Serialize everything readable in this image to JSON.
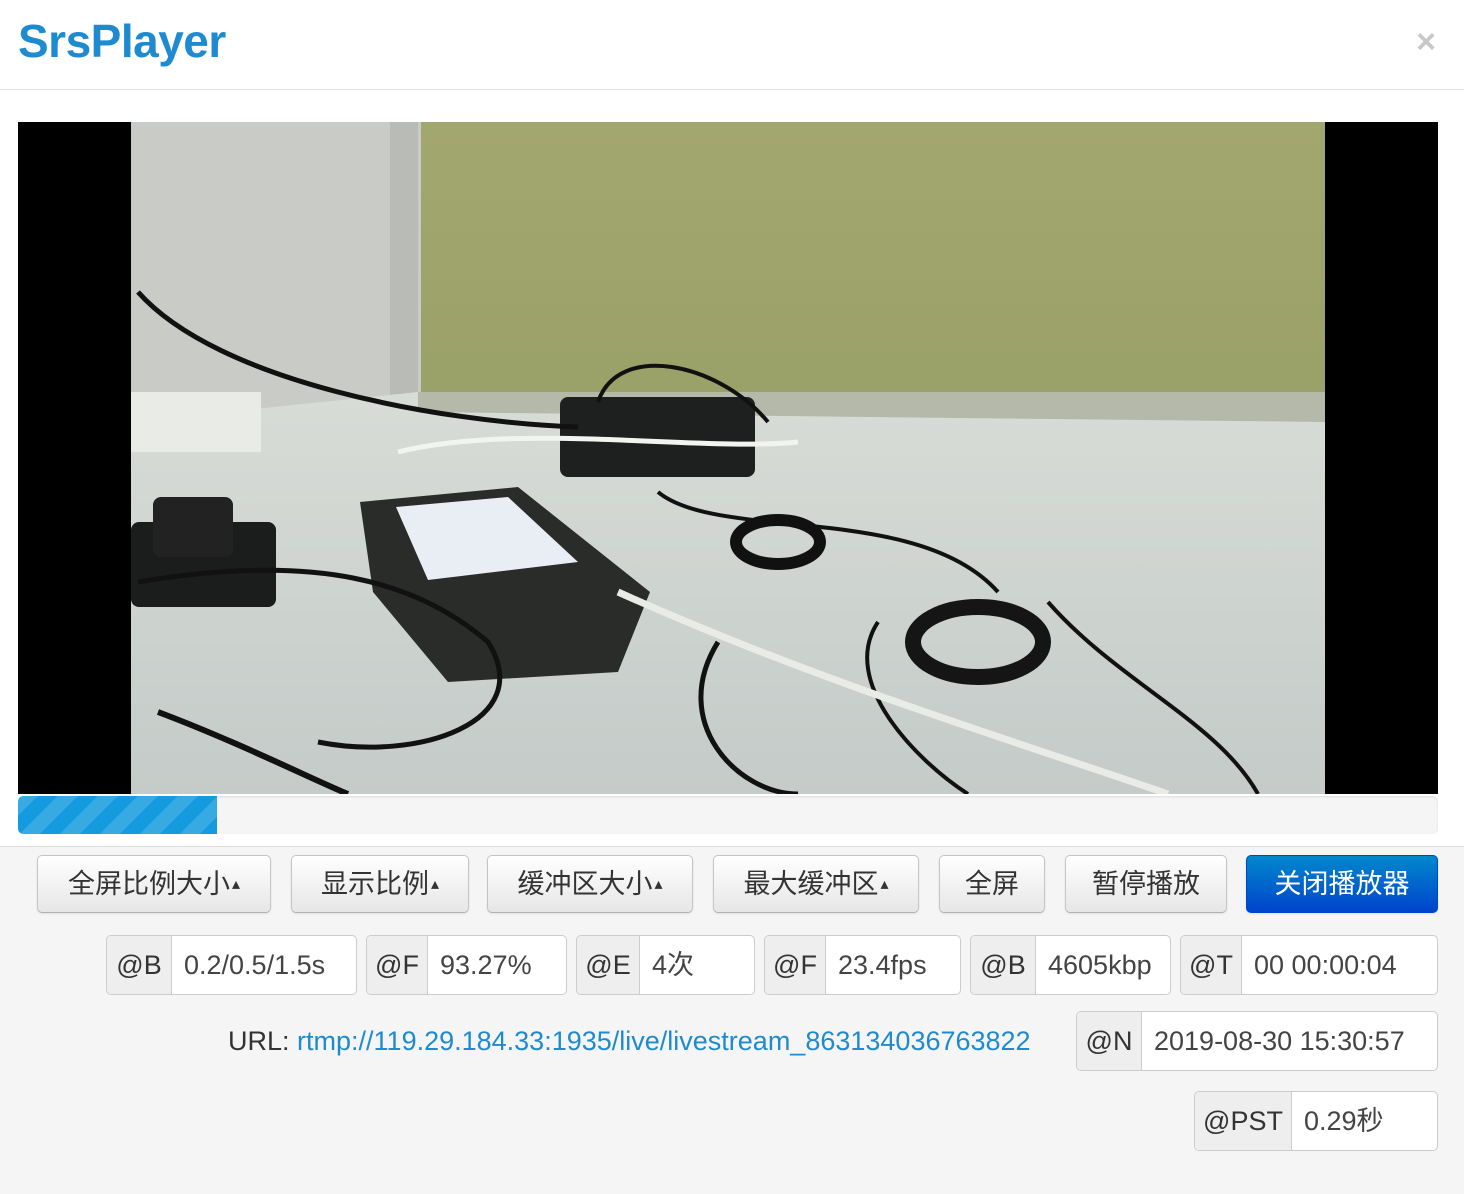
{
  "app": {
    "title": "SrsPlayer",
    "close_icon": "×"
  },
  "player": {
    "progress_fraction": 0.14
  },
  "controls": {
    "fullscreen_ratio_label": "全屏比例大小",
    "display_ratio_label": "显示比例",
    "buffer_size_label": "缓冲区大小",
    "max_buffer_label": "最大缓冲区",
    "fullscreen_label": "全屏",
    "pause_label": "暂停播放",
    "close_player_label": "关闭播放器",
    "caret": "▴"
  },
  "stats": [
    {
      "key": "@B",
      "value": "0.2/0.5/1.5s"
    },
    {
      "key": "@F",
      "value": "93.27%"
    },
    {
      "key": "@E",
      "value": "4次"
    },
    {
      "key": "@F",
      "value": "23.4fps"
    },
    {
      "key": "@B",
      "value": "4605kbp"
    },
    {
      "key": "@T",
      "value": "00 00:00:04"
    }
  ],
  "url": {
    "label": "URL:",
    "value": "rtmp://119.29.184.33:1935/live/livestream_863134036763822"
  },
  "now": {
    "key": "@N",
    "value": "2019-08-30 15:30:57"
  },
  "pst": {
    "key": "@PST",
    "value": "0.29秒"
  },
  "colors": {
    "brand": "#1e8bd1",
    "primary_button": "#0055dd",
    "progress": "#149bdf"
  }
}
